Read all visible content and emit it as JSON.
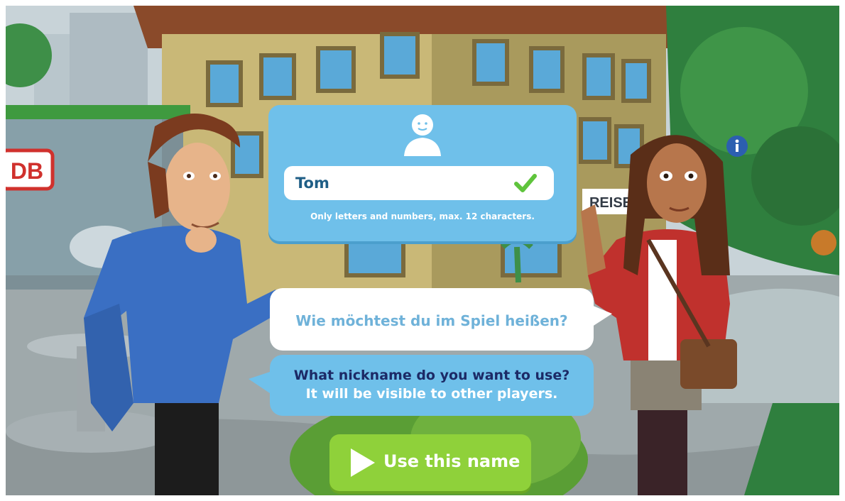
{
  "scene": {
    "station_sign": "DB",
    "shop_sign": "REISE"
  },
  "name_panel": {
    "nickname_value": "Tom",
    "hint": "Only letters and numbers, max. 12 characters."
  },
  "prompt_german": "Wie möchtest du im Spiel heißen?",
  "prompt_english": {
    "line1": "What nickname do you want to use?",
    "line2": "It will be visible to other players."
  },
  "confirm_button": {
    "label": "Use this name"
  },
  "colors": {
    "panel_blue": "#6fc0ea",
    "button_green": "#8fd13a",
    "check_green": "#5fc43c",
    "dark_navy": "#1c2a66"
  },
  "icons": [
    "user-avatar-icon",
    "checkmark-icon",
    "play-icon",
    "info-icon"
  ]
}
